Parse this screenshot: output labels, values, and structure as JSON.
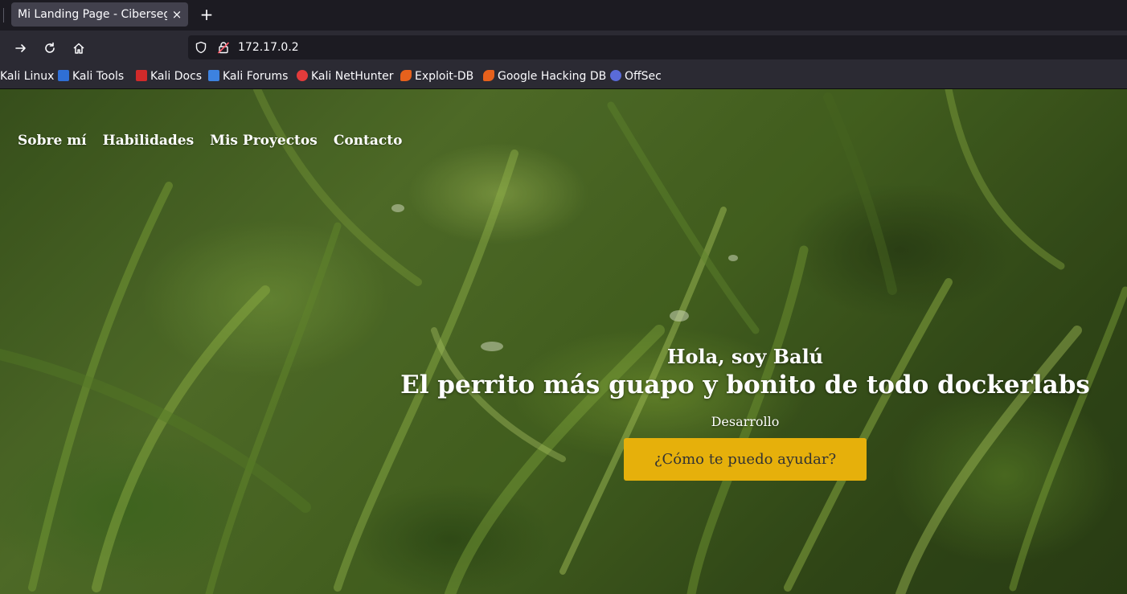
{
  "browser": {
    "tab": {
      "title": "Mi Landing Page - Ciberseguridad",
      "close_glyph": "×"
    },
    "new_tab_glyph": "+",
    "url": "172.17.0.2",
    "bookmarks": [
      {
        "label": "Kali Linux",
        "icon": "none"
      },
      {
        "label": "Kali Tools",
        "icon": "kali-tools-icon",
        "color": "#2f6fd6"
      },
      {
        "label": "Kali Docs",
        "icon": "kali-docs-icon",
        "color": "#d12a2a"
      },
      {
        "label": "Kali Forums",
        "icon": "kali-forums-icon",
        "color": "#3d82e0"
      },
      {
        "label": "Kali NetHunter",
        "icon": "kali-nethunter-icon",
        "color": "#e33b3b"
      },
      {
        "label": "Exploit-DB",
        "icon": "exploit-db-icon",
        "color": "#e6611c"
      },
      {
        "label": "Google Hacking DB",
        "icon": "ghdb-icon",
        "color": "#e6611c"
      },
      {
        "label": "OffSec",
        "icon": "offsec-icon",
        "color": "#5a6bd8"
      }
    ]
  },
  "site": {
    "nav": [
      "Sobre mí",
      "Habilidades",
      "Mis Proyectos",
      "Contacto"
    ],
    "hero": {
      "greeting": "Hola, soy Balú",
      "title": "El perrito más guapo y bonito de todo dockerlabs",
      "role": "Desarrollo",
      "cta": "¿Cómo te puedo ayudar?"
    },
    "colors": {
      "cta_bg": "#e6b00b",
      "background": "grass-photo-green"
    }
  }
}
